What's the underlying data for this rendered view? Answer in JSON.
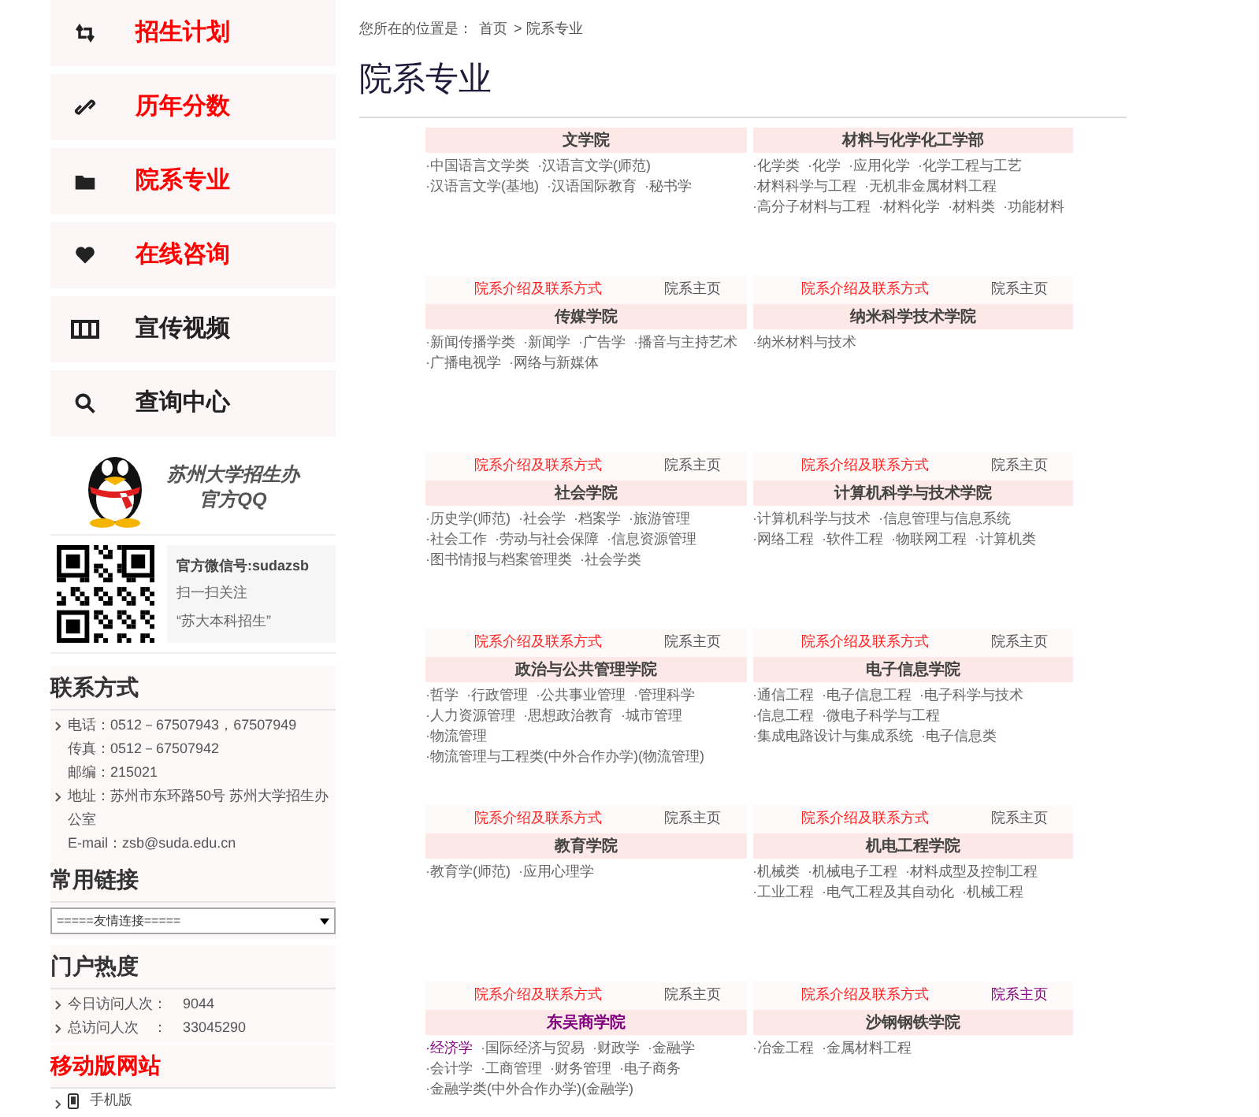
{
  "nav": [
    {
      "label": "招生计划",
      "color": "#ff0000"
    },
    {
      "label": "历年分数",
      "color": "#ff0000"
    },
    {
      "label": "院系专业",
      "color": "#ff0000"
    },
    {
      "label": "在线咨询",
      "color": "#ff0000"
    },
    {
      "label": "宣传视频",
      "color": "#222222"
    },
    {
      "label": "查询中心",
      "color": "#222222"
    }
  ],
  "qq": {
    "lines": [
      "苏州大学招生办",
      "官方QQ"
    ]
  },
  "wechat": {
    "id": "官方微信号:sudazsb",
    "lines": [
      "扫一扫关注",
      "“苏大本科招生”"
    ]
  },
  "contact": {
    "title": "联系方式",
    "items": [
      {
        "text": "电话：0512－67507943，67507949",
        "bullet": true
      },
      {
        "text": "传真：0512－67507942",
        "bullet": false
      },
      {
        "text": "邮编：215021",
        "bullet": false
      },
      {
        "text": "地址：苏州市东环路50号 苏州大学招生办公室",
        "bullet": true
      },
      {
        "text": "E-mail：zsb@suda.edu.cn",
        "bullet": false
      }
    ]
  },
  "links": {
    "title": "常用链接",
    "select": "=====友情连接====="
  },
  "stats": {
    "title": "门户热度",
    "items": [
      {
        "label": "今日访问人次：",
        "value": "9044"
      },
      {
        "label": "总访问人次　：",
        "value": "33045290"
      }
    ]
  },
  "mobile": {
    "title": "移动版网站",
    "item": "手机版"
  },
  "breadcrumb": {
    "prefix": "您所在的位置是：",
    "items": [
      "首页",
      "> 院系专业"
    ]
  },
  "page_title": "院系专业",
  "departments": [
    {
      "name": "文学院",
      "visited": false,
      "majors": [
        {
          "name": "·中国语言文学类",
          "visited": false
        },
        {
          "name": "·汉语言文学(师范)",
          "visited": false
        },
        {
          "name": "·汉语言文学(基地)",
          "visited": false
        },
        {
          "name": "·汉语国际教育",
          "visited": false
        },
        {
          "name": "·秘书学",
          "visited": false
        }
      ],
      "intro": "院系介绍及联系方式",
      "home": "院系主页",
      "home_visited": false
    },
    {
      "name": "材料与化学化工学部",
      "visited": false,
      "majors": [
        {
          "name": "·化学类",
          "visited": false
        },
        {
          "name": "·化学",
          "visited": false
        },
        {
          "name": "·应用化学",
          "visited": false
        },
        {
          "name": "·化学工程与工艺",
          "visited": false
        },
        {
          "name": "·材料科学与工程",
          "visited": false
        },
        {
          "name": "·无机非金属材料工程",
          "visited": false
        },
        {
          "name": "·高分子材料与工程",
          "visited": false
        },
        {
          "name": "·材料化学",
          "visited": false
        },
        {
          "name": "·材料类",
          "visited": false
        },
        {
          "name": "·功能材料",
          "visited": false
        }
      ],
      "intro": "院系介绍及联系方式",
      "home": "院系主页",
      "home_visited": false
    },
    {
      "name": "传媒学院",
      "visited": false,
      "majors": [
        {
          "name": "·新闻传播学类",
          "visited": false
        },
        {
          "name": "·新闻学",
          "visited": false
        },
        {
          "name": "·广告学",
          "visited": false
        },
        {
          "name": "·播音与主持艺术",
          "visited": false
        },
        {
          "name": "·广播电视学",
          "visited": false
        },
        {
          "name": "·网络与新媒体",
          "visited": false
        }
      ],
      "intro": "院系介绍及联系方式",
      "home": "院系主页",
      "home_visited": false
    },
    {
      "name": "纳米科学技术学院",
      "visited": false,
      "majors": [
        {
          "name": "·纳米材料与技术",
          "visited": false
        }
      ],
      "intro": "院系介绍及联系方式",
      "home": "院系主页",
      "home_visited": false
    },
    {
      "name": "社会学院",
      "visited": false,
      "majors": [
        {
          "name": "·历史学(师范)",
          "visited": false
        },
        {
          "name": "·社会学",
          "visited": false
        },
        {
          "name": "·档案学",
          "visited": false
        },
        {
          "name": "·旅游管理",
          "visited": false
        },
        {
          "name": "·社会工作",
          "visited": false
        },
        {
          "name": "·劳动与社会保障",
          "visited": false
        },
        {
          "name": "·信息资源管理",
          "visited": false
        },
        {
          "name": "·图书情报与档案管理类",
          "visited": false
        },
        {
          "name": "·社会学类",
          "visited": false
        }
      ],
      "intro": "院系介绍及联系方式",
      "home": "院系主页",
      "home_visited": false
    },
    {
      "name": "计算机科学与技术学院",
      "visited": false,
      "majors": [
        {
          "name": "·计算机科学与技术",
          "visited": false
        },
        {
          "name": "·信息管理与信息系统",
          "visited": false
        },
        {
          "name": "·网络工程",
          "visited": false
        },
        {
          "name": "·软件工程",
          "visited": false
        },
        {
          "name": "·物联网工程",
          "visited": false
        },
        {
          "name": "·计算机类",
          "visited": false
        }
      ],
      "intro": "院系介绍及联系方式",
      "home": "院系主页",
      "home_visited": false
    },
    {
      "name": "政治与公共管理学院",
      "visited": false,
      "majors": [
        {
          "name": "·哲学",
          "visited": false
        },
        {
          "name": "·行政管理",
          "visited": false
        },
        {
          "name": "·公共事业管理",
          "visited": false
        },
        {
          "name": "·管理科学",
          "visited": false
        },
        {
          "name": "·人力资源管理",
          "visited": false
        },
        {
          "name": "·思想政治教育",
          "visited": false
        },
        {
          "name": "·城市管理",
          "visited": false
        },
        {
          "name": "·物流管理",
          "visited": false
        },
        {
          "name": "·物流管理与工程类(中外合作办学)(物流管理)",
          "visited": false
        }
      ],
      "intro": "院系介绍及联系方式",
      "home": "院系主页",
      "home_visited": false
    },
    {
      "name": "电子信息学院",
      "visited": false,
      "majors": [
        {
          "name": "·通信工程",
          "visited": false
        },
        {
          "name": "·电子信息工程",
          "visited": false
        },
        {
          "name": "·电子科学与技术",
          "visited": false
        },
        {
          "name": "·信息工程",
          "visited": false
        },
        {
          "name": "·微电子科学与工程",
          "visited": false
        },
        {
          "name": "·集成电路设计与集成系统",
          "visited": false
        },
        {
          "name": "·电子信息类",
          "visited": false
        }
      ],
      "intro": "院系介绍及联系方式",
      "home": "院系主页",
      "home_visited": false
    },
    {
      "name": "教育学院",
      "visited": false,
      "majors": [
        {
          "name": "·教育学(师范)",
          "visited": false
        },
        {
          "name": "·应用心理学",
          "visited": false
        }
      ],
      "intro": "院系介绍及联系方式",
      "home": "院系主页",
      "home_visited": false
    },
    {
      "name": "机电工程学院",
      "visited": false,
      "majors": [
        {
          "name": "·机械类",
          "visited": false
        },
        {
          "name": "·机械电子工程",
          "visited": false
        },
        {
          "name": "·材料成型及控制工程",
          "visited": false
        },
        {
          "name": "·工业工程",
          "visited": false
        },
        {
          "name": "·电气工程及其自动化",
          "visited": false
        },
        {
          "name": "·机械工程",
          "visited": false
        }
      ],
      "intro": "院系介绍及联系方式",
      "home": "院系主页",
      "home_visited": true
    },
    {
      "name": "东吴商学院",
      "visited": true,
      "majors": [
        {
          "name": "·经济学",
          "visited": true
        },
        {
          "name": "·国际经济与贸易",
          "visited": false
        },
        {
          "name": "·财政学",
          "visited": false
        },
        {
          "name": "·金融学",
          "visited": false
        },
        {
          "name": "·会计学",
          "visited": false
        },
        {
          "name": "·工商管理",
          "visited": false
        },
        {
          "name": "·财务管理",
          "visited": false
        },
        {
          "name": "·电子商务",
          "visited": false
        },
        {
          "name": "·金融学类(中外合作办学)(金融学)",
          "visited": false
        }
      ]
    },
    {
      "name": "沙钢钢铁学院",
      "visited": false,
      "majors": [
        {
          "name": "·冶金工程",
          "visited": false
        },
        {
          "name": "·金属材料工程",
          "visited": false
        }
      ]
    }
  ]
}
